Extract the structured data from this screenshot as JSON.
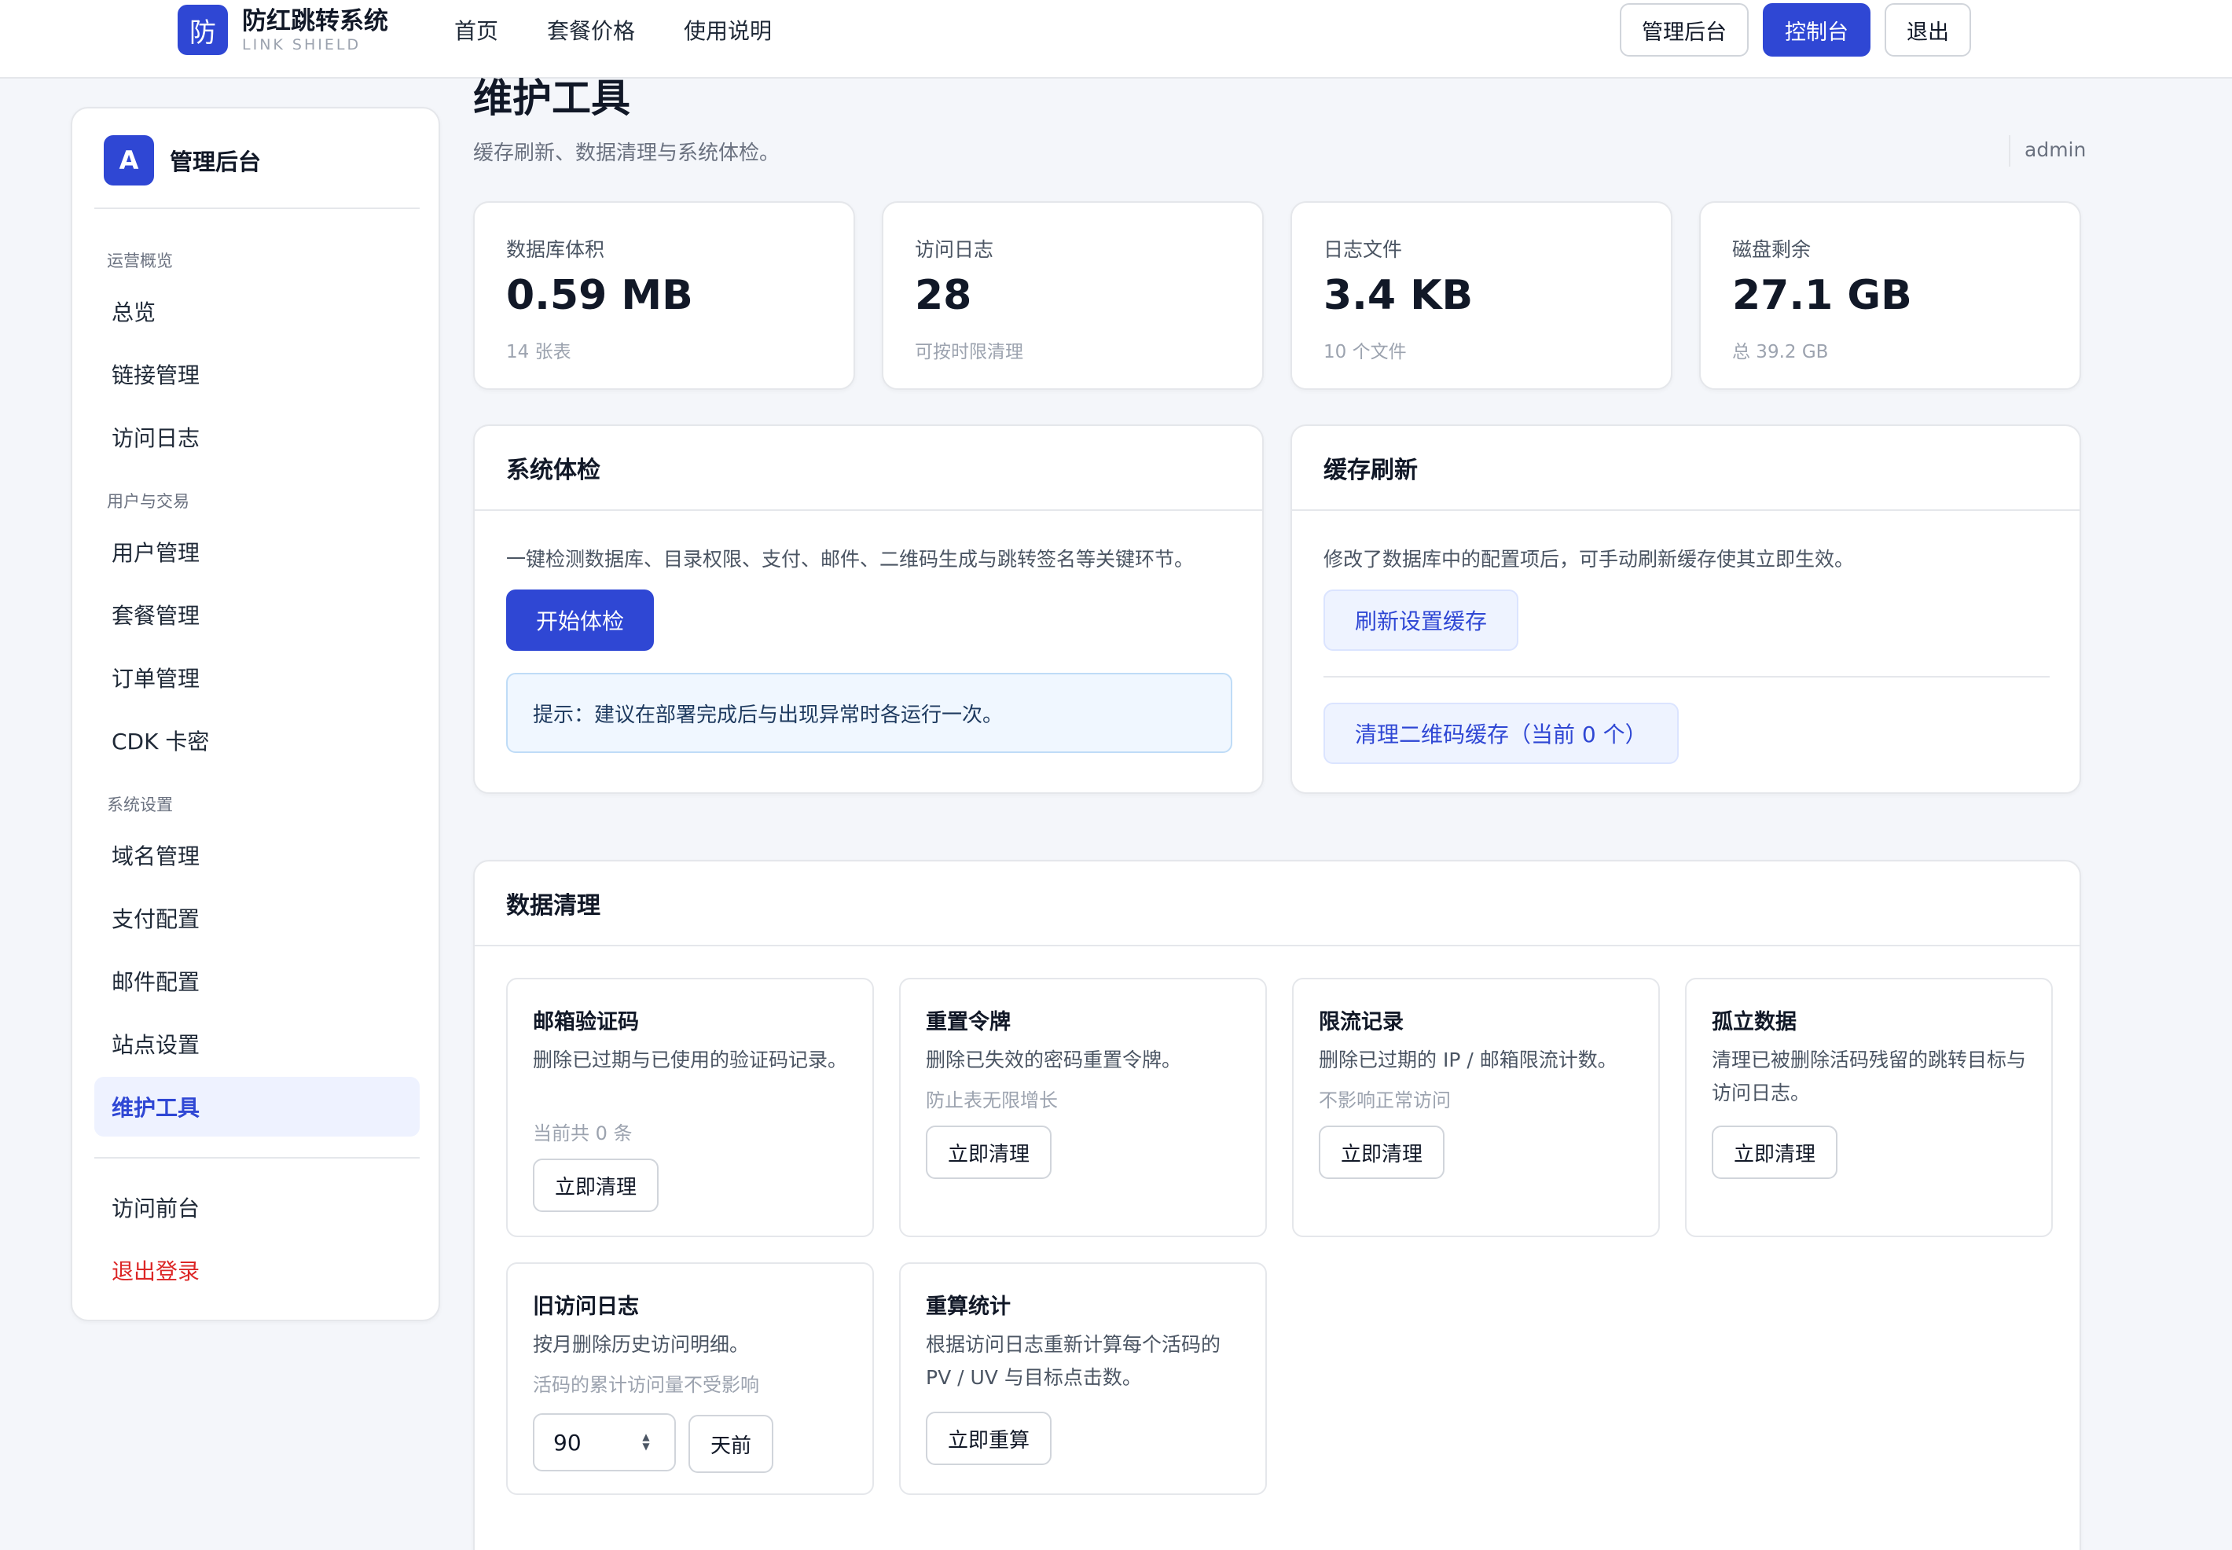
{
  "topnav": {
    "brand_logo": "防",
    "brand_name": "防红跳转系统",
    "brand_sub": "LINK SHIELD",
    "links": [
      "首页",
      "套餐价格",
      "使用说明"
    ],
    "admin_label": "管理后台",
    "console_label": "控制台",
    "logout_label": "退出"
  },
  "sidebar": {
    "avatar": "A",
    "title": "管理后台",
    "groups": {
      "overview": "运营概览",
      "users": "用户与交易",
      "settings": "系统设置"
    },
    "items": {
      "dashboard": "总览",
      "links": "链接管理",
      "visits": "访问日志",
      "users": "用户管理",
      "plans": "套餐管理",
      "orders": "订单管理",
      "cdk": "CDK 卡密",
      "domains": "域名管理",
      "payment": "支付配置",
      "mail": "邮件配置",
      "site": "站点设置",
      "maintenance": "维护工具",
      "frontend": "访问前台",
      "signout": "退出登录"
    },
    "active": "maintenance"
  },
  "header": {
    "title": "维护工具",
    "subtitle": "缓存刷新、数据清理与系统体检。",
    "user": "admin"
  },
  "stats": [
    {
      "label": "数据库体积",
      "value": "0.59 MB",
      "note": "14 张表"
    },
    {
      "label": "访问日志",
      "value": "28",
      "note": "可按时限清理"
    },
    {
      "label": "日志文件",
      "value": "3.4 KB",
      "note": "10 个文件"
    },
    {
      "label": "磁盘剩余",
      "value": "27.1 GB",
      "note": "总 39.2 GB"
    }
  ],
  "health": {
    "title": "系统体检",
    "desc": "一键检测数据库、目录权限、支付、邮件、二维码生成与跳转签名等关键环节。",
    "button": "开始体检",
    "tip": "提示：建议在部署完成后与出现异常时各运行一次。"
  },
  "cache": {
    "title": "缓存刷新",
    "desc": "修改了数据库中的配置项后，可手动刷新缓存使其立即生效。",
    "refresh_button": "刷新设置缓存",
    "qr_button": "清理二维码缓存（当前 0 个）"
  },
  "cleanup": {
    "title": "数据清理",
    "email_code": {
      "title": "邮箱验证码",
      "desc": "删除已过期与已使用的验证码记录。",
      "note": "当前共 0 条",
      "button": "立即清理"
    },
    "reset_token": {
      "title": "重置令牌",
      "desc": "删除已失效的密码重置令牌。",
      "note": "防止表无限增长",
      "button": "立即清理"
    },
    "rate_limit": {
      "title": "限流记录",
      "desc": "删除已过期的 IP / 邮箱限流计数。",
      "note": "不影响正常访问",
      "button": "立即清理"
    },
    "orphan": {
      "title": "孤立数据",
      "desc": "清理已被删除活码残留的跳转目标与访问日志。",
      "button": "立即清理"
    },
    "old_visits": {
      "title": "旧访问日志",
      "desc": "按月删除历史访问明细。",
      "note": "活码的累计访问量不受影响",
      "days_value": "90",
      "button": "天前"
    },
    "recount": {
      "title": "重算统计",
      "desc": "根据访问日志重新计算每个活码的 PV / UV 与目标点击数。",
      "button": "立即重算"
    }
  }
}
